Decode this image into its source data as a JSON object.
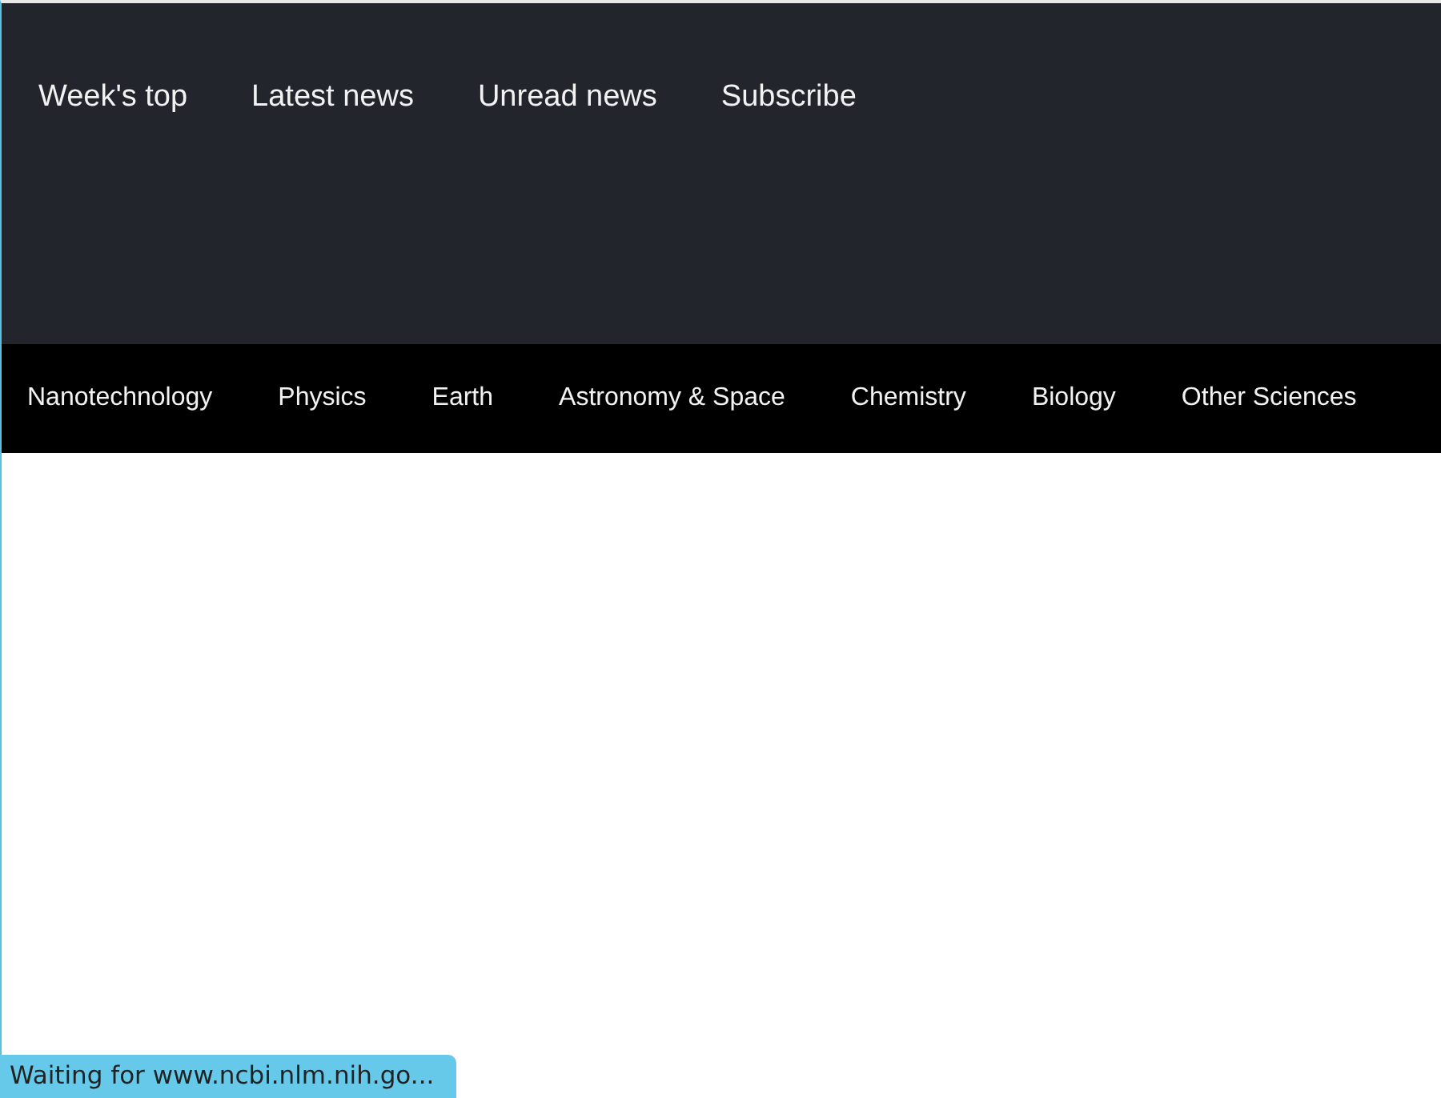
{
  "top_nav": [
    "Week's top",
    "Latest news",
    "Unread news",
    "Subscribe"
  ],
  "categories": [
    "Nanotechnology",
    "Physics",
    "Earth",
    "Astronomy & Space",
    "Chemistry",
    "Biology",
    "Other Sciences"
  ],
  "status_bar": "Waiting for www.ncbi.nlm.nih.go..."
}
